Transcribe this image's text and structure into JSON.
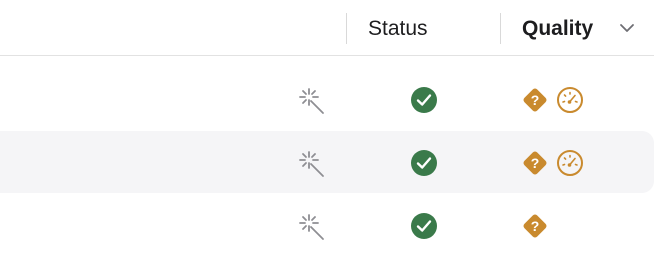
{
  "table": {
    "columns": [
      {
        "key": "status",
        "label": "Status",
        "sorted": false
      },
      {
        "key": "quality",
        "label": "Quality",
        "sorted": true,
        "sort_indicator": "chevron-down-icon"
      }
    ],
    "rows": [
      {
        "action_icon": "magic-wand-icon",
        "status_icon": "checkmark-circle-icon",
        "quality_icons": [
          "question-diamond-icon",
          "gauge-icon"
        ],
        "highlighted": false
      },
      {
        "action_icon": "magic-wand-icon",
        "status_icon": "checkmark-circle-icon",
        "quality_icons": [
          "question-diamond-icon",
          "gauge-icon"
        ],
        "highlighted": true
      },
      {
        "action_icon": "magic-wand-icon",
        "status_icon": "checkmark-circle-icon",
        "quality_icons": [
          "question-diamond-icon"
        ],
        "highlighted": false
      }
    ]
  },
  "colors": {
    "status_ok": "#3a7a4a",
    "quality_warning": "#c98a2e",
    "icon_gray": "#8e8e93",
    "row_highlight": "#f5f5f7",
    "divider": "#d9d9d9"
  }
}
